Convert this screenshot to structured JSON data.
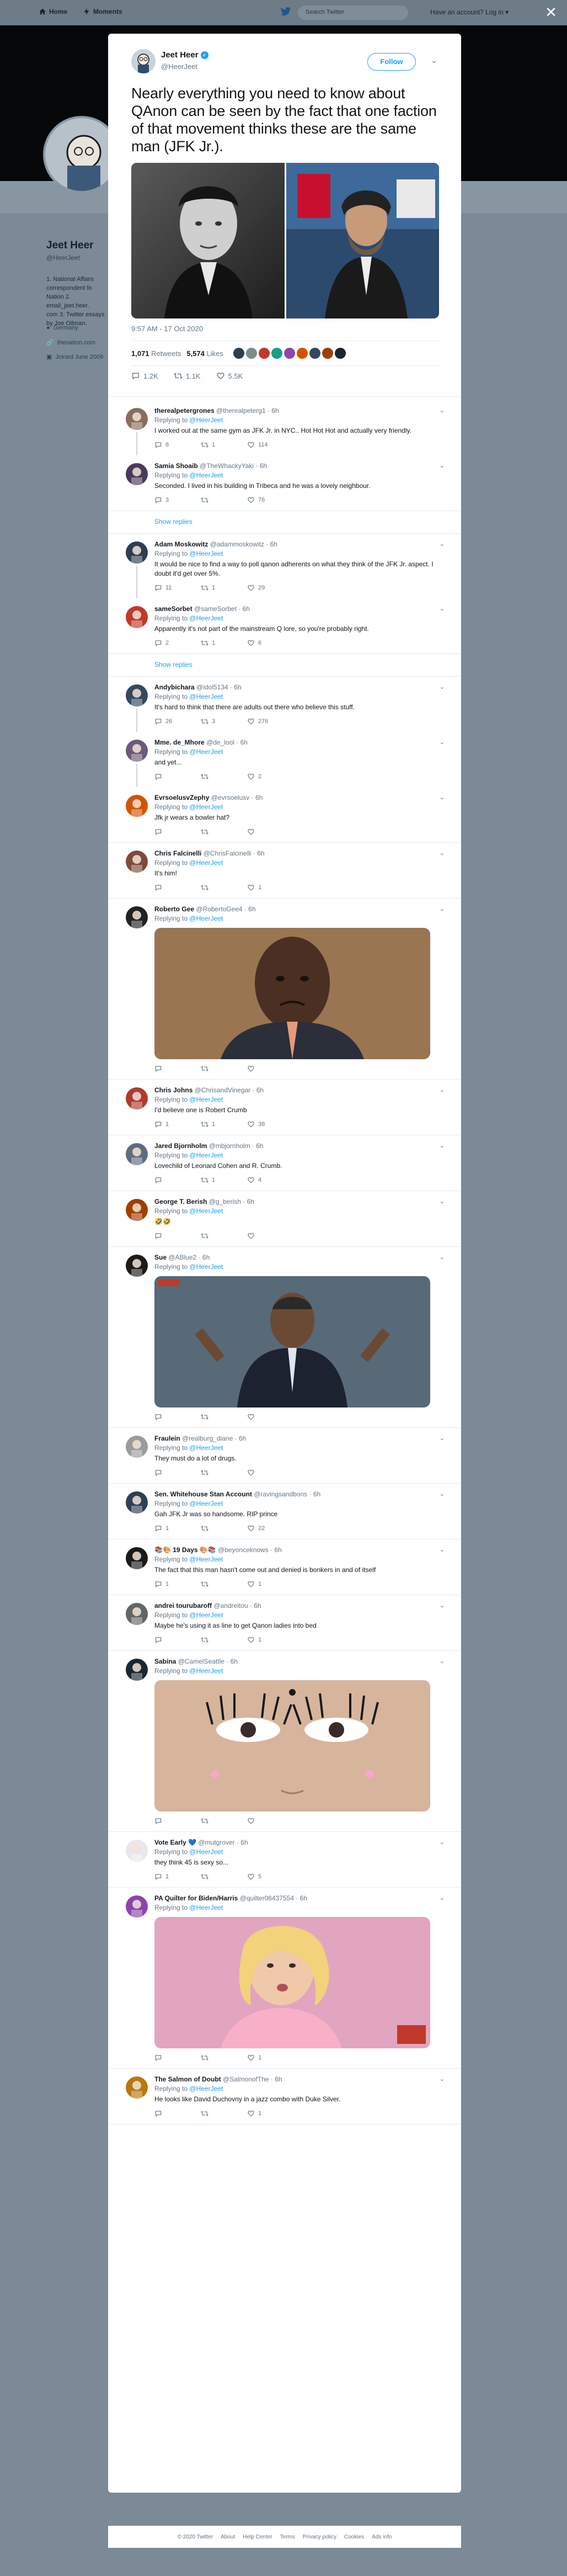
{
  "topnav": {
    "home": "Home",
    "moments": "Moments",
    "search_placeholder": "Search Twitter",
    "login": "Have an account? Log in ▾"
  },
  "background_profile": {
    "name": "Jeet Heer",
    "handle": "@HeerJeet",
    "bio": "1. National Affairs correspondent fo\nNation 2. email_jeet.heer.\ncom 3. Twitter essays\nby Joe Oilman.",
    "location": "Germany",
    "link": "thenation.com",
    "joined": "Joined June 2009"
  },
  "main_tweet": {
    "name": "Jeet Heer",
    "handle": "@HeerJeet",
    "follow_label": "Follow",
    "text": "Nearly everything you need to know about QAnon can be seen by the fact that one faction of that movement thinks these are the same man (JFK Jr.).",
    "timestamp": "9:57 AM - 17 Oct 2020",
    "retweets_count": "1,071",
    "retweets_label": "Retweets",
    "likes_count": "5,574",
    "likes_label": "Likes",
    "actions": {
      "reply": "1.2K",
      "retweet": "1.1K",
      "like": "5.5K"
    }
  },
  "replying_to_label": "Replying to",
  "replying_to_handle": "@HeerJeet",
  "show_replies_label": "Show replies",
  "replies": [
    {
      "name": "therealpetergrones",
      "handle": "@therealpeterg1",
      "time": "6h",
      "text": "I worked out at the same gym as JFK Jr. in NYC.. Hot Hot Hot and actually very friendly.",
      "reply": "8",
      "retweet": "1",
      "like": "114",
      "color": "#8a6d5c"
    },
    {
      "name": "Samia Shoaib",
      "handle": "@TheWhackyYaki",
      "time": "6h",
      "text": "Seconded. I lived in his building in Tribeca and he was a lovely neighbour.",
      "reply": "3",
      "retweet": "",
      "like": "76",
      "color": "#4a3a5a"
    },
    {
      "name": "Adam Moskowitz",
      "handle": "@adammoskowitz",
      "time": "6h",
      "text": "It would be nice to find a way to poll qanon adherents on what they think of the JFK Jr. aspect. I doubt it'd get over 5%.",
      "reply": "11",
      "retweet": "1",
      "like": "29",
      "color": "#2c3e50"
    },
    {
      "name": "sameSorbet",
      "handle": "@sameSorbet",
      "time": "6h",
      "text": "Apparently it's not part of the mainstream Q lore, so you're probably right.",
      "reply": "2",
      "retweet": "1",
      "like": "6",
      "color": "#c0392b"
    },
    {
      "name": "Andybichara",
      "handle": "@idol5134",
      "time": "6h",
      "text": "It's hard to think that there are adults out there who believe this stuff.",
      "reply": "26",
      "retweet": "3",
      "like": "276",
      "color": "#34495e"
    },
    {
      "name": "Mme. de_Mhore",
      "handle": "@de_lool",
      "time": "6h",
      "text": "and yet...",
      "reply": "",
      "retweet": "",
      "like": "2",
      "color": "#6c5a7a"
    },
    {
      "name": "EvrsoelusvZephy",
      "handle": "@evrsoelusv",
      "time": "6h",
      "text": "Jfk jr wears a bowler hat?",
      "reply": "",
      "retweet": "",
      "like": "",
      "color": "#d35400"
    },
    {
      "name": "Chris Falcinelli",
      "handle": "@ChrisFalcinelli",
      "time": "6h",
      "text": "It's him!",
      "reply": "",
      "retweet": "",
      "like": "1",
      "color": "#7f4a3a"
    },
    {
      "name": "Roberto Gee",
      "handle": "@RobertoGee4",
      "time": "6h",
      "text": "",
      "reply": "",
      "retweet": "",
      "like": "",
      "color": "#222222"
    },
    {
      "name": "Chris Johns",
      "handle": "@ChrisandVinegar",
      "time": "6h",
      "text": "I'd believe one is Robert Crumb",
      "reply": "1",
      "retweet": "1",
      "like": "38",
      "color": "#b03a2e"
    },
    {
      "name": "Jared Bjornholm",
      "handle": "@mbjornholm",
      "time": "6h",
      "text": "Lovechild of Leonard Cohen and R. Crumb.",
      "reply": "",
      "retweet": "1",
      "like": "4",
      "color": "#5d6d7e"
    },
    {
      "name": "George T. Berish",
      "handle": "@g_berish",
      "time": "6h",
      "text": "🤣🤣",
      "reply": "",
      "retweet": "",
      "like": "",
      "color": "#a04000"
    },
    {
      "name": "Sue",
      "handle": "@ABlue2",
      "time": "6h",
      "text": "",
      "reply": "",
      "retweet": "",
      "like": "",
      "color": "#1b1b1b"
    },
    {
      "name": "Fraulein",
      "handle": "@realburg_diane",
      "time": "6h",
      "text": "They must do a lot of drugs.",
      "reply": "",
      "retweet": "",
      "like": "",
      "color": "#9b9b9b"
    },
    {
      "name": "Sen. Whitehouse Stan Account",
      "handle": "@ravingsandbons",
      "time": "6h",
      "text": "Gah JFK Jr was so handsome. RIP prince",
      "reply": "1",
      "retweet": "",
      "like": "22",
      "color": "#2e4053"
    },
    {
      "name": "📚🎨 19 Days 🎨📚",
      "handle": "@beyonceknows",
      "time": "6h",
      "text": "The fact that this man hasn't come out and denied is bonkers in and of itself",
      "reply": "1",
      "retweet": "",
      "like": "1",
      "color": "#1a1a1a"
    },
    {
      "name": "andrei tourubaroff",
      "handle": "@andreitou",
      "time": "6h",
      "text": "Maybe he's using it as line to get Qanon ladies into bed",
      "reply": "",
      "retweet": "",
      "like": "1",
      "color": "#626567"
    },
    {
      "name": "Sabina",
      "handle": "@CamelSeattle",
      "time": "6h",
      "text": "",
      "reply": "",
      "retweet": "",
      "like": "",
      "color": "#1b2631"
    },
    {
      "name": "Vote Early 💙",
      "handle": "@mutgrover",
      "time": "6h",
      "text": "they think 45 is sexy so...",
      "reply": "1",
      "retweet": "",
      "like": "5",
      "color": "#e8e8e8"
    },
    {
      "name": "PA Quilter for Biden/Harris",
      "handle": "@quilter06437554",
      "time": "6h",
      "text": "",
      "reply": "",
      "retweet": "",
      "like": "1",
      "color": "#8e44ad"
    },
    {
      "name": "The Salmon of Doubt",
      "handle": "@SalmonofThe",
      "time": "6h",
      "text": "He looks like David Duchovny in a jazz combo with Duke Silver.",
      "reply": "",
      "retweet": "",
      "like": "1",
      "color": "#b9770e"
    }
  ],
  "footer": [
    "© 2020 Twitter",
    "About",
    "Help Center",
    "Terms",
    "Privacy policy",
    "Cookies",
    "Ads info"
  ],
  "colors": {
    "accent": "#1da1f2",
    "overlay": "#7b8a96",
    "text_secondary": "#657786"
  }
}
